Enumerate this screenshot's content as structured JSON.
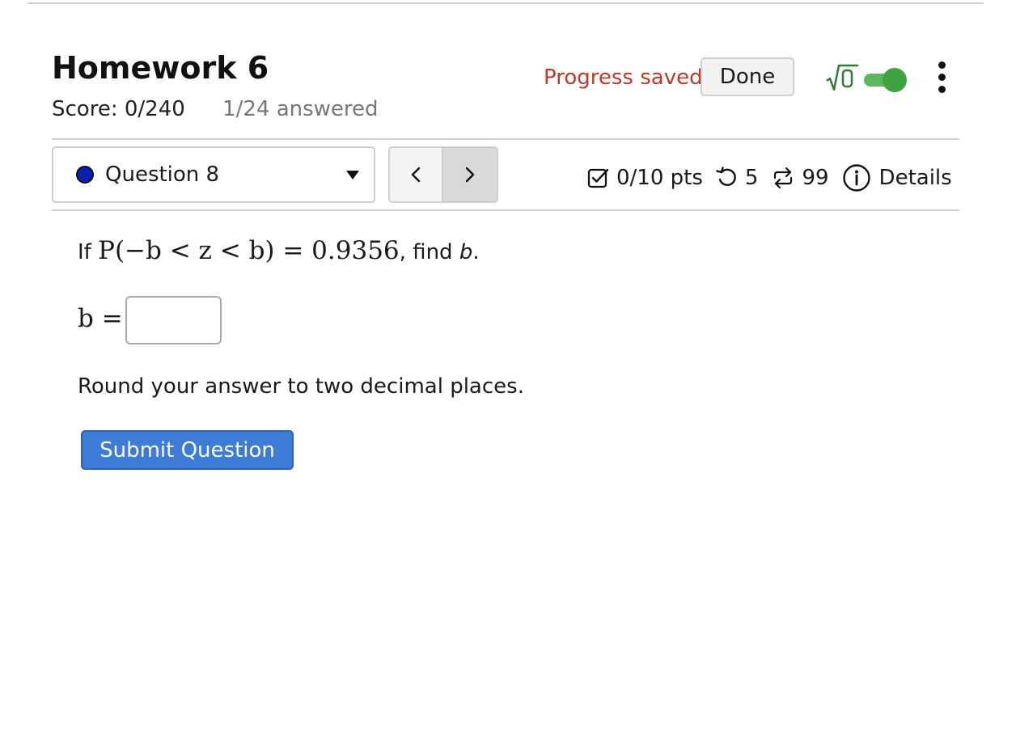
{
  "header": {
    "title": "Homework 6",
    "score": "Score: 0/240",
    "answered": "1/24 answered",
    "progress_status": "Progress saved",
    "done_label": "Done",
    "math_toggle_icon": "sqrt-icon",
    "math_toggle_on": true,
    "more_icon": "kebab-menu-icon"
  },
  "question_nav": {
    "selected": "Question 8",
    "status_color": "#0a1fb5",
    "prev_label": "<",
    "next_label": ">"
  },
  "question_meta": {
    "points": "0/10 pts",
    "points_icon": "checkbox-icon",
    "attempts": "5",
    "attempts_icon": "retry-icon",
    "versions": "99",
    "versions_icon": "shuffle-icon",
    "details_label": "Details",
    "details_icon": "info-icon"
  },
  "question": {
    "prefix": "If",
    "expression": "P(−b < z < b) = 0.9356",
    "middle": ", find",
    "variable": "b",
    "suffix": ".",
    "answer_label": "b =",
    "answer_value": "",
    "instructions": "Round your answer to two decimal places.",
    "submit_label": "Submit Question"
  },
  "colors": {
    "accent": "#3c7bd6",
    "progress_saved": "#c0392b",
    "toggle_on": "#3fa33f",
    "sqrt_icon": "#2e7d32"
  }
}
